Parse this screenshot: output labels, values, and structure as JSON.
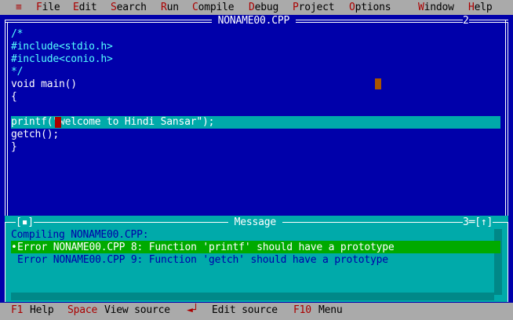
{
  "menu": {
    "system": "≡",
    "items": [
      {
        "hot": "F",
        "rest": "ile"
      },
      {
        "hot": "E",
        "rest": "dit"
      },
      {
        "hot": "S",
        "rest": "earch"
      },
      {
        "hot": "R",
        "rest": "un"
      },
      {
        "hot": "C",
        "rest": "ompile"
      },
      {
        "hot": "D",
        "rest": "ebug"
      },
      {
        "hot": "P",
        "rest": "roject"
      },
      {
        "hot": "O",
        "rest": "ptions"
      },
      {
        "hot": "W",
        "rest": "indow"
      },
      {
        "hot": "H",
        "rest": "elp"
      }
    ]
  },
  "editor": {
    "title": " NONAME00.CPP ",
    "window_number": "2",
    "lines": [
      "/*",
      "#include<stdio.h>",
      "#include<conio.h>",
      "*/",
      "void main()",
      "{",
      "",
      "printf(\"welcome to Hindi Sansar\");",
      "getch();",
      "}"
    ]
  },
  "message_window": {
    "title": " Message ",
    "left_icon": "[▪]",
    "right_label": "3═[↑]",
    "lines": [
      "Compiling NONAME00.CPP:",
      "Error NONAME00.CPP 8: Function 'printf' should have a prototype",
      "Error NONAME00.CPP 9: Function 'getch' should have a prototype"
    ],
    "selected_marker": "•"
  },
  "status": {
    "f1_key": "F1",
    "f1_label": "Help",
    "space_key": "Space",
    "space_label": "View source",
    "enter_key": "◄┘",
    "enter_label": "Edit source",
    "f10_key": "F10",
    "f10_label": "Menu"
  },
  "colors": {
    "background": "#0000aa",
    "menubar": "#aaaaaa",
    "hotkey": "#aa0000",
    "highlight": "#00aaaa",
    "selected_error": "#00aa00"
  }
}
